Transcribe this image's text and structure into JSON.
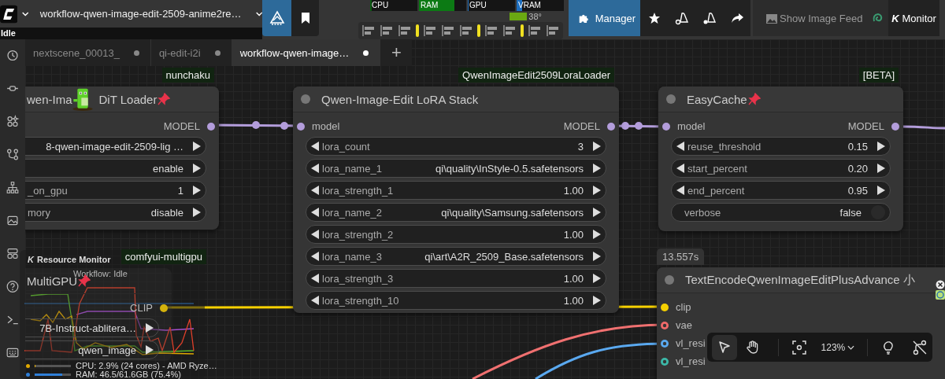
{
  "app": {
    "status": "Idle"
  },
  "topbar": {
    "workflow_title": "workflow-qwen-image-edit-2509-anime2re…",
    "meters": [
      {
        "label": "CPU",
        "level": 0.03,
        "color": "#0b5a12"
      },
      {
        "label": "RAM",
        "level": 0.75,
        "color": "#0c7a14"
      },
      {
        "label": "GPU",
        "level": 0.02,
        "color": "#1e6fbf"
      },
      {
        "label": "VRAM",
        "level": 0.12,
        "color": "#1e6fbf"
      }
    ],
    "temperature": "38°",
    "manager_label": "Manager",
    "image_feed_label": "Show Image Feed",
    "monitor_glyph": "K",
    "monitor_label": "Monitor"
  },
  "tabs": [
    {
      "label": "nextscene_00013_",
      "selected": false
    },
    {
      "label": "qi-edit-i2i",
      "selected": false
    },
    {
      "label": "workflow-qwen-image…",
      "selected": true
    }
  ],
  "tab_add": "+",
  "nodes": [
    {
      "badge": "nunchaku",
      "title": "wen-Ima",
      "mascot": true,
      "title_tail": "DiT Loader",
      "pinned": true,
      "outputs": [
        {
          "name": "MODEL",
          "color": "#b39ddb",
          "kind": "dot"
        }
      ],
      "widgets": [
        {
          "kind": "combo",
          "value": "8-qwen-image-edit-2509-lig …"
        },
        {
          "kind": "combo",
          "value": "enable"
        },
        {
          "kind": "number",
          "label": "_on_gpu",
          "value": "1"
        },
        {
          "kind": "combo",
          "label": "mory",
          "value": "disable"
        }
      ]
    },
    {
      "badge": "QwenImageEdit2509LoraLoader",
      "title": "Qwen-Image-Edit LoRA Stack",
      "pinned": false,
      "inputs": [
        {
          "name": "model",
          "color": "#b39ddb",
          "kind": "dot"
        }
      ],
      "outputs": [
        {
          "name": "MODEL",
          "color": "#b39ddb",
          "kind": "dot"
        }
      ],
      "widgets": [
        {
          "kind": "number",
          "label": "lora_count",
          "value": "3"
        },
        {
          "kind": "combo",
          "label": "lora_name_1",
          "value": "qi\\quality\\InStyle-0.5.safetensors"
        },
        {
          "kind": "number",
          "label": "lora_strength_1",
          "value": "1.00"
        },
        {
          "kind": "combo",
          "label": "lora_name_2",
          "value": "qi\\quality\\Samsung.safetensors"
        },
        {
          "kind": "number",
          "label": "lora_strength_2",
          "value": "1.00"
        },
        {
          "kind": "combo",
          "label": "lora_name_3",
          "value": "qi\\art\\A2R_2509_Base.safetensors"
        },
        {
          "kind": "number",
          "label": "lora_strength_3",
          "value": "1.00"
        },
        {
          "kind": "number",
          "label": "lora_strength_10",
          "value": "1.00"
        }
      ]
    },
    {
      "badge": "[BETA]",
      "title": "EasyCache",
      "pinned": true,
      "inputs": [
        {
          "name": "model",
          "color": "#b39ddb",
          "kind": "dot"
        }
      ],
      "outputs": [
        {
          "name": "MODEL",
          "color": "#b39ddb",
          "kind": "dot"
        }
      ],
      "widgets": [
        {
          "kind": "number",
          "label": "reuse_threshold",
          "value": "0.15"
        },
        {
          "kind": "number",
          "label": "start_percent",
          "value": "0.20"
        },
        {
          "kind": "number",
          "label": "end_percent",
          "value": "0.95"
        },
        {
          "kind": "toggle",
          "label": "verbose",
          "value": "false",
          "on": false
        }
      ]
    },
    {
      "badge": "comfyui-multigpu",
      "title": "MultiGPU",
      "pinned": true,
      "outputs": [
        {
          "name": "CLIP",
          "color": "#d4b20c",
          "kind": "dot"
        }
      ],
      "widgets": [
        {
          "kind": "combo",
          "value": "7B-Instruct-ablitera…"
        },
        {
          "kind": "combo",
          "value": "qwen_image"
        }
      ]
    },
    {
      "timing": "13.557s",
      "title": "TextEncodeQwenImageEditPlusAdvance 小",
      "pinned": false,
      "inputs": [
        {
          "name": "clip",
          "color": "#f5d000",
          "kind": "dot"
        },
        {
          "name": "vae",
          "color": "#f06a6a",
          "kind": "ring"
        },
        {
          "name": "vl_resi",
          "color": "#5aa9f0",
          "kind": "ring"
        },
        {
          "name": "vl_resi",
          "color": "#3cb8a8",
          "kind": "ring"
        }
      ]
    }
  ],
  "resource_monitor": {
    "glyph": "K",
    "title": "Resource Monitor",
    "workflow_status": "Workflow: Idle",
    "stats": [
      {
        "text": "CPU: 2.9% (24 cores) - AMD Ryze…",
        "level": 0.03,
        "color": "#e0a800"
      },
      {
        "text": "RAM: 46.5/61.6GB (75.4%)",
        "level": 0.75,
        "color": "#2f7fd8"
      }
    ]
  },
  "canvas_toolbar": {
    "tools": [
      {
        "kind": "select",
        "selected": true
      },
      {
        "kind": "hand",
        "selected": false
      }
    ],
    "zoom": "123%"
  }
}
